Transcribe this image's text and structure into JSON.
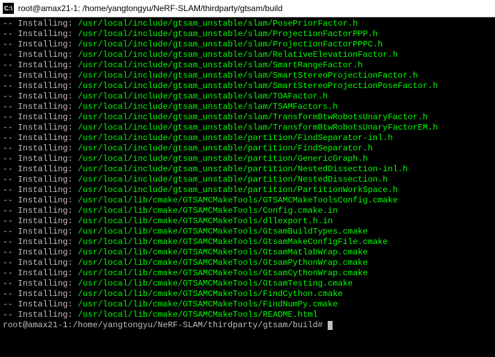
{
  "titlebar": {
    "icon_label": "C:\\",
    "title": "root@amax21-1: /home/yangtongyu/NeRF-SLAM/thirdparty/gtsam/build"
  },
  "install_prefix": "-- Installing: ",
  "lines": [
    "/usr/local/include/gtsam_unstable/slam/PosePriorFactor.h",
    "/usr/local/include/gtsam_unstable/slam/ProjectionFactorPPP.h",
    "/usr/local/include/gtsam_unstable/slam/ProjectionFactorPPPC.h",
    "/usr/local/include/gtsam_unstable/slam/RelativeElevationFactor.h",
    "/usr/local/include/gtsam_unstable/slam/SmartRangeFactor.h",
    "/usr/local/include/gtsam_unstable/slam/SmartStereoProjectionFactor.h",
    "/usr/local/include/gtsam_unstable/slam/SmartStereoProjectionPoseFactor.h",
    "/usr/local/include/gtsam_unstable/slam/TOAFactor.h",
    "/usr/local/include/gtsam_unstable/slam/TSAMFactors.h",
    "/usr/local/include/gtsam_unstable/slam/TransformBtwRobotsUnaryFactor.h",
    "/usr/local/include/gtsam_unstable/slam/TransformBtwRobotsUnaryFactorEM.h",
    "/usr/local/include/gtsam_unstable/partition/FindSeparator-inl.h",
    "/usr/local/include/gtsam_unstable/partition/FindSeparator.h",
    "/usr/local/include/gtsam_unstable/partition/GenericGraph.h",
    "/usr/local/include/gtsam_unstable/partition/NestedDissection-inl.h",
    "/usr/local/include/gtsam_unstable/partition/NestedDissection.h",
    "/usr/local/include/gtsam_unstable/partition/PartitionWorkSpace.h",
    "/usr/local/lib/cmake/GTSAMCMakeTools/GTSAMCMakeToolsConfig.cmake",
    "/usr/local/lib/cmake/GTSAMCMakeTools/Config.cmake.in",
    "/usr/local/lib/cmake/GTSAMCMakeTools/dllexport.h.in",
    "/usr/local/lib/cmake/GTSAMCMakeTools/GtsamBuildTypes.cmake",
    "/usr/local/lib/cmake/GTSAMCMakeTools/GtsamMakeConfigFile.cmake",
    "/usr/local/lib/cmake/GTSAMCMakeTools/GtsamMatlabWrap.cmake",
    "/usr/local/lib/cmake/GTSAMCMakeTools/GtsamPythonWrap.cmake",
    "/usr/local/lib/cmake/GTSAMCMakeTools/GtsamCythonWrap.cmake",
    "/usr/local/lib/cmake/GTSAMCMakeTools/GtsamTesting.cmake",
    "/usr/local/lib/cmake/GTSAMCMakeTools/FindCython.cmake",
    "/usr/local/lib/cmake/GTSAMCMakeTools/FindNumPy.cmake",
    "/usr/local/lib/cmake/GTSAMCMakeTools/README.html"
  ],
  "prompt": "root@amax21-1:/home/yangtongyu/NeRF-SLAM/thirdparty/gtsam/build#"
}
